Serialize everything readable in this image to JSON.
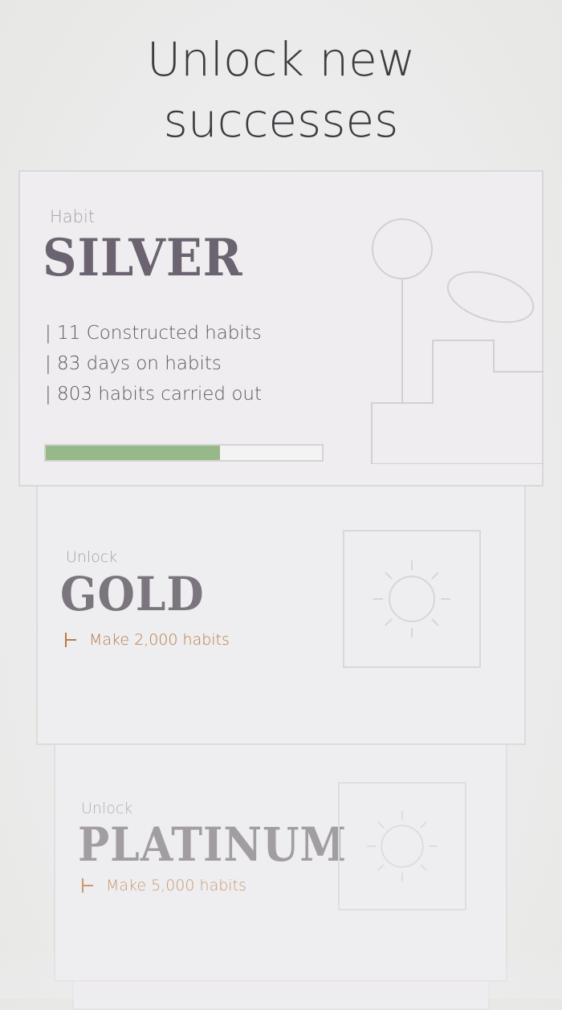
{
  "header": {
    "title_line1": "Unlock new",
    "title_line2": "successes"
  },
  "cards": {
    "silver": {
      "kicker": "Habit",
      "tier": "SILVER",
      "stats": [
        "| 11 Constructed habits",
        "| 83 days on habits",
        "| 803 habits carried out"
      ],
      "progress": 0.63,
      "progress_color": "#97b98a",
      "illustration_icon": "podium-trophy-icon"
    },
    "gold": {
      "kicker": "Unlock",
      "tier": "GOLD",
      "requirement": "Make 2,000 habits",
      "requirement_color": "#b87b48",
      "locked_icon": "sun-icon"
    },
    "platinum": {
      "kicker": "Unlock",
      "tier": "PLATINUM",
      "requirement": "Make 5,000 habits",
      "requirement_color": "#c99a72",
      "locked_icon": "sun-icon"
    }
  }
}
